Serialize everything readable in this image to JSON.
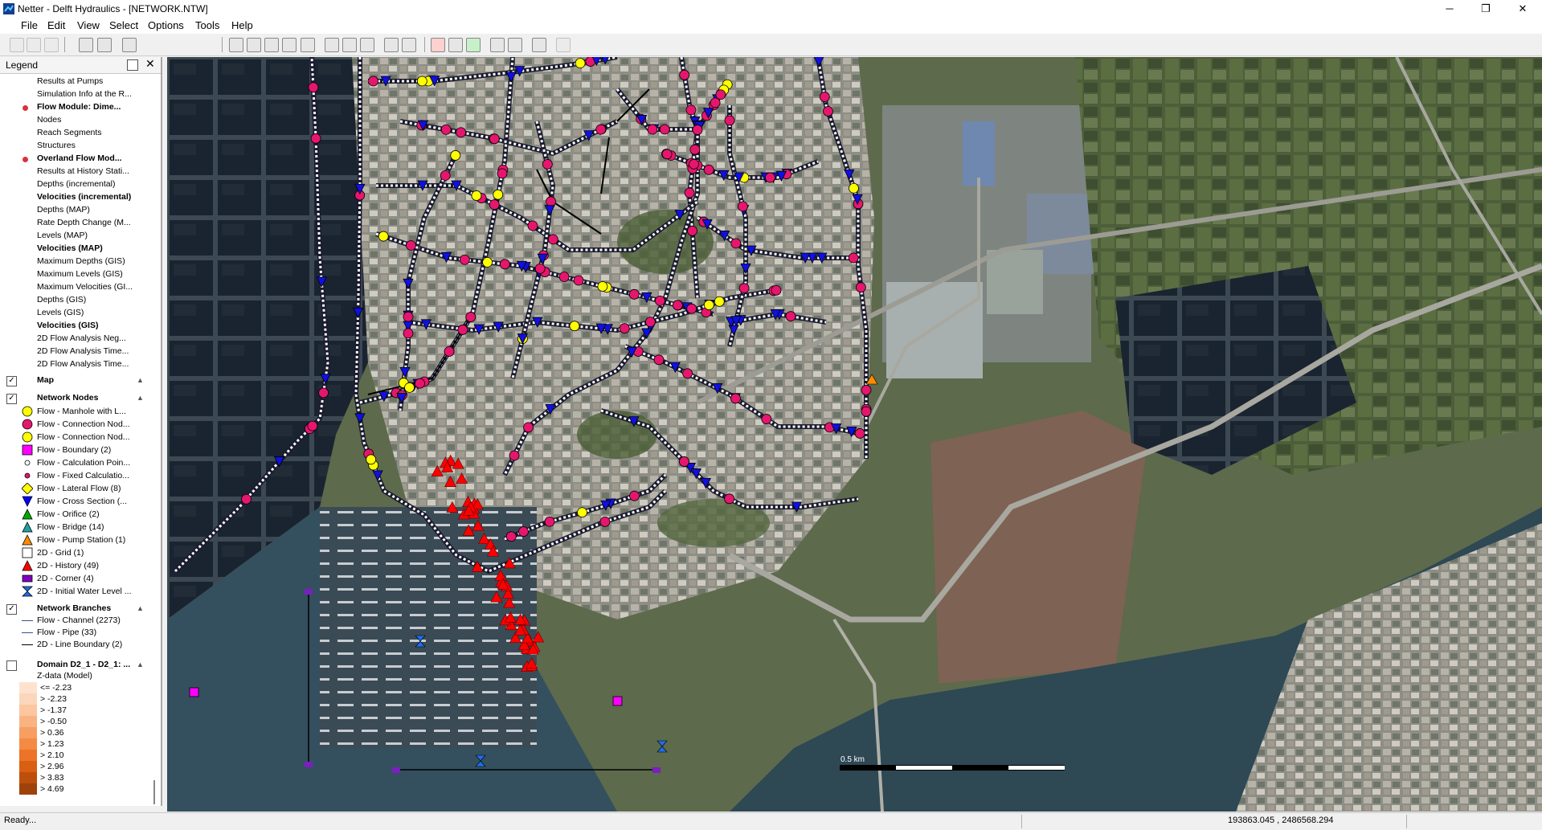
{
  "window": {
    "title": "Netter - Delft Hydraulics - [NETWORK.NTW]",
    "minimize_glyph": "─",
    "maximize_glyph": "❐",
    "close_glyph": "✕"
  },
  "menu": {
    "items": [
      "File",
      "Edit",
      "View",
      "Select",
      "Options",
      "Tools",
      "Help"
    ]
  },
  "toolbar": {
    "icons": [
      "open-icon",
      "save-icon",
      "save-as-icon",
      "new-icon",
      "print-icon",
      "help-icon",
      "zoom-in-icon",
      "zoom-out-icon",
      "zoom-extent-icon",
      "pan-icon",
      "select-arrow-icon",
      "zoom-window-icon",
      "zoom-layer-icon",
      "zoom-selection-icon",
      "edit-mode-icon",
      "measure-icon",
      "add-node-icon",
      "select-node-icon",
      "connect-icon",
      "properties-icon",
      "report-icon",
      "info-icon",
      "map-tool-icon"
    ]
  },
  "legend": {
    "title": "Legend",
    "close_glyph": "✕",
    "items": [
      {
        "label": "Results at Pumps",
        "bold": false
      },
      {
        "label": "Simulation Info at the R...",
        "bold": false
      },
      {
        "label": "Flow Module: Dime...",
        "bold": true,
        "dot": true
      },
      {
        "label": "Nodes",
        "bold": false
      },
      {
        "label": "Reach Segments",
        "bold": false
      },
      {
        "label": "Structures",
        "bold": false
      },
      {
        "label": "Overland Flow Mod...",
        "bold": true,
        "dot": true
      },
      {
        "label": "Results at History Stati...",
        "bold": false
      },
      {
        "label": "Depths (incremental)",
        "bold": false
      },
      {
        "label": "Velocities (incremental)",
        "bold": true
      },
      {
        "label": "Depths (MAP)",
        "bold": false
      },
      {
        "label": "Rate Depth Change (M...",
        "bold": false
      },
      {
        "label": "Levels (MAP)",
        "bold": false
      },
      {
        "label": "Velocities (MAP)",
        "bold": true
      },
      {
        "label": "Maximum Depths (GIS)",
        "bold": false
      },
      {
        "label": "Maximum Levels (GIS)",
        "bold": false
      },
      {
        "label": "Maximum Velocities (GI...",
        "bold": false
      },
      {
        "label": "Depths (GIS)",
        "bold": false
      },
      {
        "label": "Levels (GIS)",
        "bold": false
      },
      {
        "label": "Velocities (GIS)",
        "bold": true
      },
      {
        "label": "2D Flow Analysis Neg...",
        "bold": false
      },
      {
        "label": "2D Flow Analysis Time...",
        "bold": false
      },
      {
        "label": "2D Flow Analysis Time...",
        "bold": false
      }
    ],
    "map_group": "Map",
    "nodes_group": "Network Nodes",
    "node_types": [
      {
        "label": "Flow - Manhole with L...",
        "symbol": "circle",
        "color": "#ffff00"
      },
      {
        "label": "Flow - Connection Nod...",
        "symbol": "circle",
        "color": "#e6166e"
      },
      {
        "label": "Flow - Connection Nod...",
        "symbol": "circle",
        "color": "#ffff00"
      },
      {
        "label": "Flow - Boundary (2)",
        "symbol": "square",
        "color": "#ff00ff"
      },
      {
        "label": "Flow - Calculation Poin...",
        "symbol": "small-circle",
        "color": "#ffffff"
      },
      {
        "label": "Flow - Fixed Calculatio...",
        "symbol": "small-circle",
        "color": "#e6166e"
      },
      {
        "label": "Flow - Lateral Flow (8)",
        "symbol": "diamond",
        "color": "#ffff00"
      },
      {
        "label": "Flow - Cross Section (...",
        "symbol": "down-triangle",
        "color": "#0000ff"
      },
      {
        "label": "Flow - Orifice (2)",
        "symbol": "triangle",
        "color": "#00aa00"
      },
      {
        "label": "Flow - Bridge (14)",
        "symbol": "triangle",
        "color": "#1fa0a0"
      },
      {
        "label": "Flow - Pump Station (1)",
        "symbol": "triangle",
        "color": "#ff8c00"
      },
      {
        "label": "2D - Grid (1)",
        "symbol": "square-outline",
        "color": "#ffffff"
      },
      {
        "label": "2D - History (49)",
        "symbol": "triangle",
        "color": "#ff0000"
      },
      {
        "label": "2D - Corner (4)",
        "symbol": "rect",
        "color": "#8000c0"
      },
      {
        "label": "2D - Initial Water Level ...",
        "symbol": "hourglass",
        "color": "#1e6ee6"
      }
    ],
    "branches_group": "Network Branches",
    "branch_types": [
      {
        "label": "Flow - Channel (2273)",
        "color": "#3a4ea0"
      },
      {
        "label": "Flow - Pipe (33)",
        "color": "#3a4ea0"
      },
      {
        "label": "2D - Line Boundary (2)",
        "color": "#000000"
      }
    ],
    "domain_group": "Domain D2_1 - D2_1: ...",
    "zdata_title": "Z-data (Model)",
    "zdata_classes": [
      {
        "label": "<= -2.23",
        "color": "#fde3cf"
      },
      {
        "label": "> -2.23",
        "color": "#fcd6ba"
      },
      {
        "label": "> -1.37",
        "color": "#fbc6a0"
      },
      {
        "label": "> -0.50",
        "color": "#f9b383"
      },
      {
        "label": "> 0.36",
        "color": "#f79e62"
      },
      {
        "label": "> 1.23",
        "color": "#f48a44"
      },
      {
        "label": "> 2.10",
        "color": "#ec7328"
      },
      {
        "label": "> 2.96",
        "color": "#d95f12"
      },
      {
        "label": "> 3.83",
        "color": "#bd4f0c"
      },
      {
        "label": "> 4.69",
        "color": "#9e420a"
      }
    ]
  },
  "map": {
    "scale_label": "0.5 km"
  },
  "status": {
    "text": "Ready...",
    "coordinates": "193863.045 , 2486568.294"
  }
}
